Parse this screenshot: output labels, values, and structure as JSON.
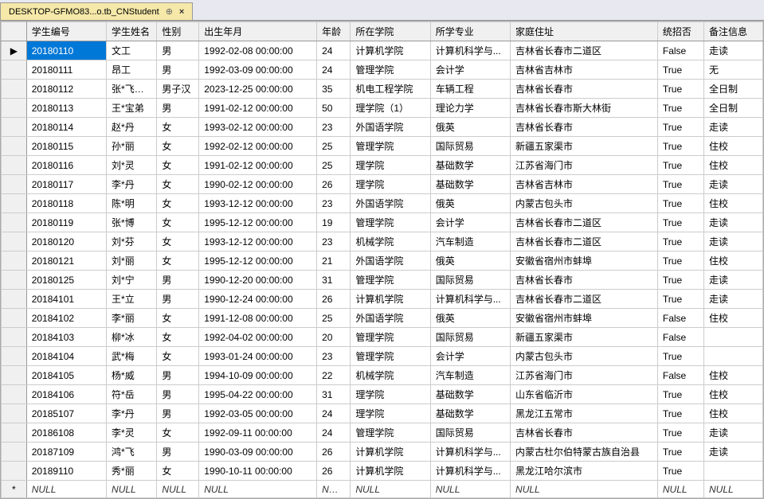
{
  "tab": {
    "title": "DESKTOP-GFMO83...o.tb_CNStudent"
  },
  "columns": [
    "学生编号",
    "学生姓名",
    "性别",
    "出生年月",
    "年龄",
    "所在学院",
    "所学专业",
    "家庭住址",
    "统招否",
    "备注信息"
  ],
  "selected": {
    "row": 0,
    "col": 0
  },
  "rows": [
    {
      "marker": "▶",
      "id": "20180110",
      "name": "文工",
      "gender": "男",
      "birth": "1992-02-08 00:00:00",
      "age": "24",
      "college": "计算机学院",
      "major": "计算机科学与...",
      "address": "吉林省长春市二道区",
      "enroll": "False",
      "remark": "走读"
    },
    {
      "marker": "",
      "id": "20180111",
      "name": "昂工",
      "gender": "男",
      "birth": "1992-03-09 00:00:00",
      "age": "24",
      "college": "管理学院",
      "major": "会计学",
      "address": "吉林省吉林市",
      "enroll": "True",
      "remark": "无"
    },
    {
      "marker": "",
      "id": "20180112",
      "name": "张*飞哥哥",
      "gender": "男子汉",
      "birth": "2023-12-25 00:00:00",
      "age": "35",
      "college": "机电工程学院",
      "major": "车辆工程",
      "address": "吉林省长春市",
      "enroll": "True",
      "remark": "全日制"
    },
    {
      "marker": "",
      "id": "20180113",
      "name": "王*宝弟",
      "gender": "男",
      "birth": "1991-02-12 00:00:00",
      "age": "50",
      "college": "理学院（1）",
      "major": "理论力学",
      "address": "吉林省长春市斯大林街",
      "enroll": "True",
      "remark": "全日制"
    },
    {
      "marker": "",
      "id": "20180114",
      "name": "赵*丹",
      "gender": "女",
      "birth": "1993-02-12 00:00:00",
      "age": "23",
      "college": "外国语学院",
      "major": "俄英",
      "address": "吉林省长春市",
      "enroll": "True",
      "remark": "走读"
    },
    {
      "marker": "",
      "id": "20180115",
      "name": "孙*丽",
      "gender": "女",
      "birth": "1992-02-12 00:00:00",
      "age": "25",
      "college": "管理学院",
      "major": "国际贸易",
      "address": "新疆五家渠市",
      "enroll": "True",
      "remark": "住校"
    },
    {
      "marker": "",
      "id": "20180116",
      "name": "刘*灵",
      "gender": "女",
      "birth": "1991-02-12 00:00:00",
      "age": "25",
      "college": "理学院",
      "major": "基础数学",
      "address": "江苏省海门市",
      "enroll": "True",
      "remark": "住校"
    },
    {
      "marker": "",
      "id": "20180117",
      "name": "李*丹",
      "gender": "女",
      "birth": "1990-02-12 00:00:00",
      "age": "26",
      "college": "理学院",
      "major": "基础数学",
      "address": "吉林省吉林市",
      "enroll": "True",
      "remark": "走读"
    },
    {
      "marker": "",
      "id": "20180118",
      "name": "陈*明",
      "gender": "女",
      "birth": "1993-12-12 00:00:00",
      "age": "23",
      "college": "外国语学院",
      "major": "俄英",
      "address": "内蒙古包头市",
      "enroll": "True",
      "remark": "住校"
    },
    {
      "marker": "",
      "id": "20180119",
      "name": "张*博",
      "gender": "女",
      "birth": "1995-12-12 00:00:00",
      "age": "19",
      "college": "管理学院",
      "major": "会计学",
      "address": "吉林省长春市二道区",
      "enroll": "True",
      "remark": "走读"
    },
    {
      "marker": "",
      "id": "20180120",
      "name": "刘*芬",
      "gender": "女",
      "birth": "1993-12-12 00:00:00",
      "age": "23",
      "college": "机械学院",
      "major": "汽车制造",
      "address": "吉林省长春市二道区",
      "enroll": "True",
      "remark": "走读"
    },
    {
      "marker": "",
      "id": "20180121",
      "name": "刘*丽",
      "gender": "女",
      "birth": "1995-12-12 00:00:00",
      "age": "21",
      "college": "外国语学院",
      "major": "俄英",
      "address": "安徽省宿州市蚌埠",
      "enroll": "True",
      "remark": "住校"
    },
    {
      "marker": "",
      "id": "20180125",
      "name": "刘*宁",
      "gender": "男",
      "birth": "1990-12-20 00:00:00",
      "age": "31",
      "college": "管理学院",
      "major": "国际贸易",
      "address": "吉林省长春市",
      "enroll": "True",
      "remark": "走读"
    },
    {
      "marker": "",
      "id": "20184101",
      "name": "王*立",
      "gender": "男",
      "birth": "1990-12-24 00:00:00",
      "age": "26",
      "college": "计算机学院",
      "major": "计算机科学与...",
      "address": "吉林省长春市二道区",
      "enroll": "True",
      "remark": "走读"
    },
    {
      "marker": "",
      "id": "20184102",
      "name": "李*丽",
      "gender": "女",
      "birth": "1991-12-08 00:00:00",
      "age": "25",
      "college": "外国语学院",
      "major": "俄英",
      "address": "安徽省宿州市蚌埠",
      "enroll": "False",
      "remark": "住校"
    },
    {
      "marker": "",
      "id": "20184103",
      "name": "柳*冰",
      "gender": "女",
      "birth": "1992-04-02 00:00:00",
      "age": "20",
      "college": "管理学院",
      "major": "国际贸易",
      "address": "新疆五家渠市",
      "enroll": "False",
      "remark": ""
    },
    {
      "marker": "",
      "id": "20184104",
      "name": "武*梅",
      "gender": "女",
      "birth": "1993-01-24 00:00:00",
      "age": "23",
      "college": "管理学院",
      "major": "会计学",
      "address": "内蒙古包头市",
      "enroll": "True",
      "remark": ""
    },
    {
      "marker": "",
      "id": "20184105",
      "name": "杨*威",
      "gender": "男",
      "birth": "1994-10-09 00:00:00",
      "age": "22",
      "college": "机械学院",
      "major": "汽车制造",
      "address": "江苏省海门市",
      "enroll": "False",
      "remark": "住校"
    },
    {
      "marker": "",
      "id": "20184106",
      "name": "符*岳",
      "gender": "男",
      "birth": "1995-04-22 00:00:00",
      "age": "31",
      "college": "理学院",
      "major": "基础数学",
      "address": "山东省临沂市",
      "enroll": "True",
      "remark": "住校"
    },
    {
      "marker": "",
      "id": "20185107",
      "name": "李*丹",
      "gender": "男",
      "birth": "1992-03-05 00:00:00",
      "age": "24",
      "college": "理学院",
      "major": "基础数学",
      "address": "黑龙江五常市",
      "enroll": "True",
      "remark": "住校"
    },
    {
      "marker": "",
      "id": "20186108",
      "name": "李*灵",
      "gender": "女",
      "birth": "1992-09-11 00:00:00",
      "age": "24",
      "college": "管理学院",
      "major": "国际贸易",
      "address": "吉林省长春市",
      "enroll": "True",
      "remark": "走读"
    },
    {
      "marker": "",
      "id": "20187109",
      "name": "鸿*飞",
      "gender": "男",
      "birth": "1990-03-09 00:00:00",
      "age": "26",
      "college": "计算机学院",
      "major": "计算机科学与...",
      "address": "内蒙古杜尔伯特蒙古族自治县",
      "enroll": "True",
      "remark": "走读"
    },
    {
      "marker": "",
      "id": "20189110",
      "name": "秀*丽",
      "gender": "女",
      "birth": "1990-10-11 00:00:00",
      "age": "26",
      "college": "计算机学院",
      "major": "计算机科学与...",
      "address": "黑龙江哈尔滨市",
      "enroll": "True",
      "remark": ""
    }
  ],
  "newRowMarker": "*",
  "nullText": "NULL"
}
